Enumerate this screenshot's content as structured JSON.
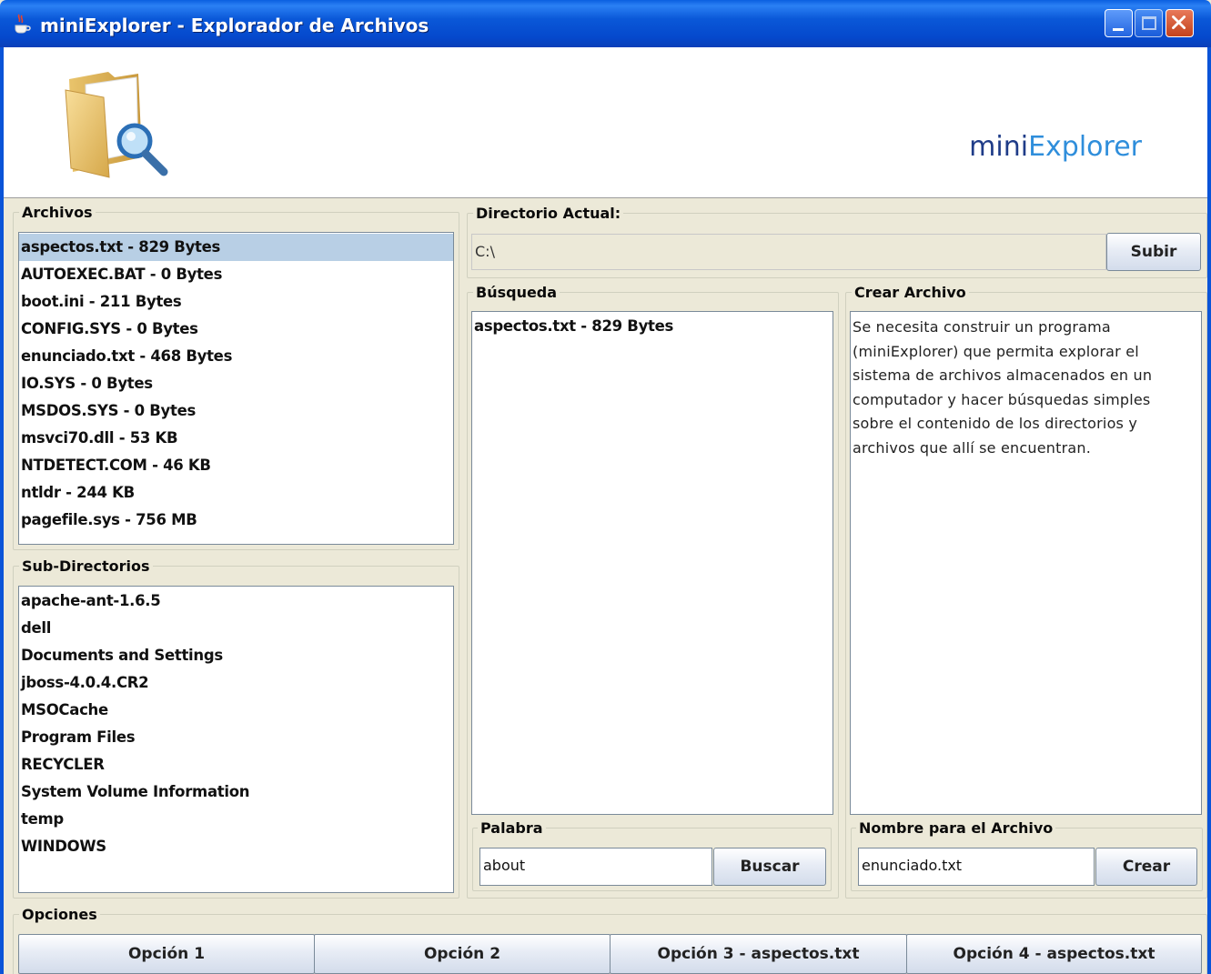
{
  "window": {
    "title": "miniExplorer - Explorador de Archivos"
  },
  "banner": {
    "brand_part1": "mini",
    "brand_part2": "Explorer"
  },
  "archivos": {
    "title": "Archivos",
    "items": [
      "aspectos.txt - 829 Bytes",
      "AUTOEXEC.BAT - 0 Bytes",
      "boot.ini - 211 Bytes",
      "CONFIG.SYS - 0 Bytes",
      "enunciado.txt - 468 Bytes",
      "IO.SYS - 0 Bytes",
      "MSDOS.SYS - 0 Bytes",
      "msvci70.dll - 53 KB",
      "NTDETECT.COM - 46 KB",
      "ntldr - 244 KB",
      "pagefile.sys - 756 MB"
    ],
    "selected_index": 0
  },
  "subdirectorios": {
    "title": "Sub-Directorios",
    "items": [
      "apache-ant-1.6.5",
      "dell",
      "Documents and Settings",
      "jboss-4.0.4.CR2",
      "MSOCache",
      "Program Files",
      "RECYCLER",
      "System Volume Information",
      "temp",
      "WINDOWS"
    ]
  },
  "directorio": {
    "title": "Directorio Actual:",
    "path": "C:\\",
    "subir_label": "Subir"
  },
  "busqueda": {
    "title": "Búsqueda",
    "results": [
      "aspectos.txt - 829 Bytes"
    ],
    "palabra_title": "Palabra",
    "palabra_value": "about",
    "buscar_label": "Buscar"
  },
  "crear": {
    "title": "Crear Archivo",
    "content_lines": [
      "Se necesita construir un programa",
      "(miniExplorer) que permita explorar el",
      "sistema de archivos almacenados en un",
      "computador y hacer búsquedas simples",
      "sobre el contenido de los directorios y",
      "archivos que allí se encuentran."
    ],
    "nombre_title": "Nombre para el Archivo",
    "nombre_value": "enunciado.txt",
    "crear_label": "Crear"
  },
  "opciones": {
    "title": "Opciones",
    "buttons": [
      "Opción 1",
      "Opción 2",
      "Opción 3 - aspectos.txt",
      "Opción 4 - aspectos.txt"
    ]
  },
  "colors": {
    "selection": "#B8CFE5",
    "titlebar": "#0A58D8",
    "brand_dark": "#1F3C88",
    "brand_light": "#2F8EDB"
  }
}
